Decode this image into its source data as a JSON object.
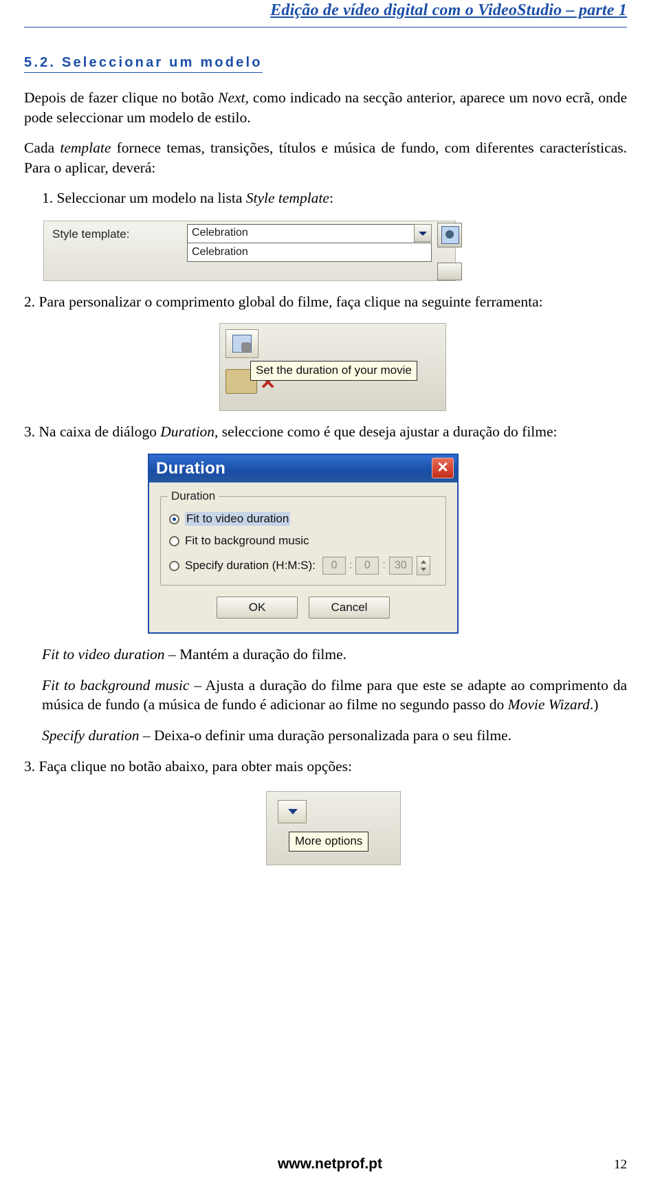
{
  "header": {
    "title": "Edição de vídeo digital com o VideoStudio – parte 1"
  },
  "section": {
    "title": "5.2. Seleccionar um modelo"
  },
  "paragraphs": {
    "p1_a": "Depois de fazer clique no botão ",
    "p1_b": "Next",
    "p1_c": ", como indicado na secção anterior, aparece um novo ecrã, onde pode seleccionar um modelo de estilo.",
    "p2_a": "Cada ",
    "p2_b": "template",
    "p2_c": " fornece temas, transições, títulos e música de fundo, com diferentes características. Para o aplicar, deverá:",
    "step1_a": "1. Seleccionar um modelo na lista ",
    "step1_b": "Style template",
    "step1_c": ":",
    "step2": "2. Para personalizar o comprimento global do filme, faça clique na seguinte ferramenta:",
    "step3_a": "3. Na caixa de diálogo ",
    "step3_b": "Duration",
    "step3_c": ", seleccione como é que deseja ajustar a duração do filme:",
    "desc1_a": "Fit to video duration",
    "desc1_b": " – Mantém a duração do filme.",
    "desc2_a": "Fit to background music",
    "desc2_b": " – Ajusta a duração do filme para que este se adapte ao comprimento da música de fundo (a música de fundo é adicionar ao filme no segundo passo do ",
    "desc2_c": "Movie Wizard",
    "desc2_d": ".)",
    "desc3_a": "Specify duration",
    "desc3_b": " – Deixa-o definir uma duração personalizada para o seu filme.",
    "step4": "3. Faça clique no botão abaixo, para obter mais opções:"
  },
  "style_template_figure": {
    "label": "Style template:",
    "combo_value": "Celebration",
    "list_item": "Celebration",
    "dropdown_icon": "chevron-down-icon",
    "tool_icon": "template-settings-icon"
  },
  "set_duration_figure": {
    "tooltip": "Set the duration of your movie",
    "tool_icon": "duration-settings-icon",
    "folder_icon": "folder-icon",
    "delete_icon": "red-x-icon"
  },
  "duration_dialog": {
    "title": "Duration",
    "close_icon": "close-icon",
    "close_label": "✕",
    "group_legend": "Duration",
    "options": [
      {
        "label": "Fit to video duration",
        "checked": true
      },
      {
        "label": "Fit to background music",
        "checked": false
      },
      {
        "label": "Specify duration (H:M:S):",
        "checked": false
      }
    ],
    "spin_values": [
      "0",
      "0",
      "30"
    ],
    "separator": ":",
    "buttons": {
      "ok": "OK",
      "cancel": "Cancel"
    }
  },
  "more_options_figure": {
    "tooltip": "More options",
    "button_icon": "chevron-down-icon"
  },
  "footer": {
    "site": "www.netprof.pt",
    "page": "12"
  },
  "colors": {
    "accent_blue": "#1b4ea8",
    "title_bar": "#1a4da5",
    "close_red": "#c42c17",
    "tooltip_yellow": "#fcfce6"
  }
}
